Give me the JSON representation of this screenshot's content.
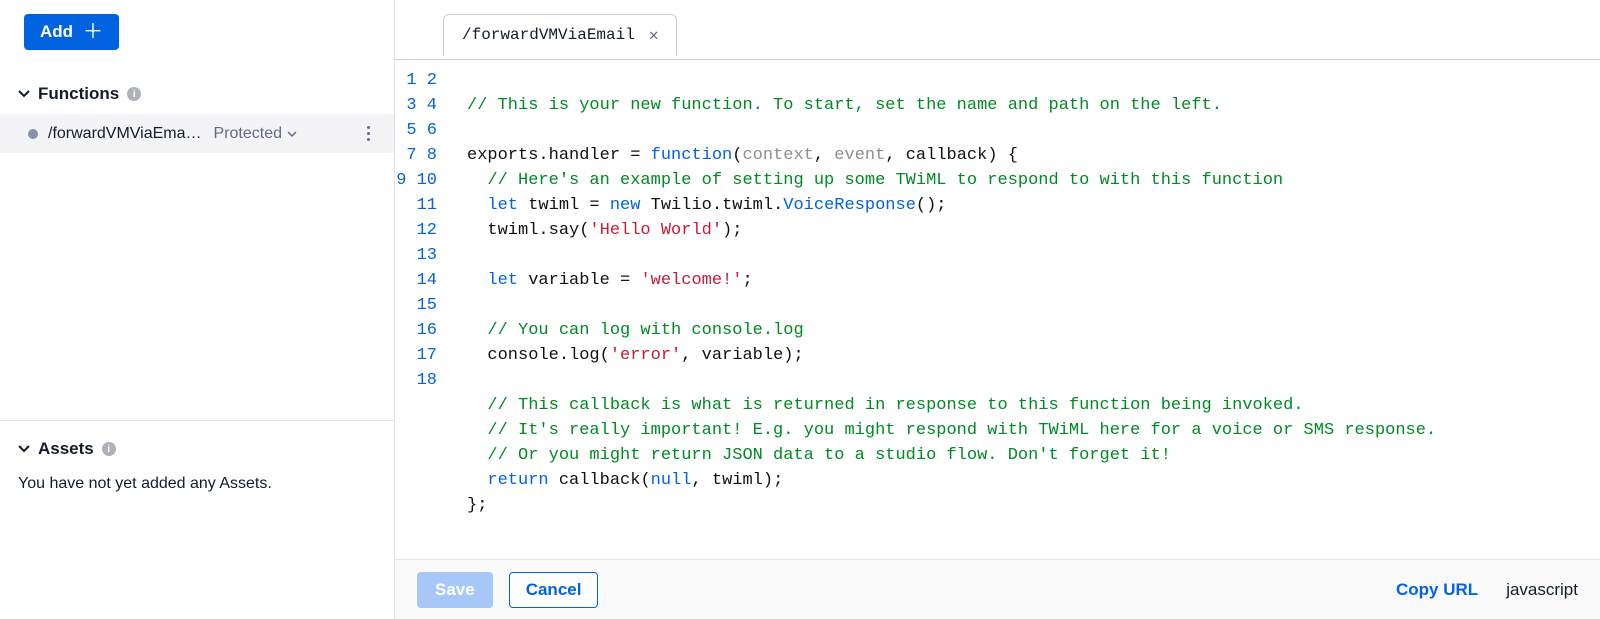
{
  "sidebar": {
    "add_label": "Add",
    "functions_header": "Functions",
    "assets_header": "Assets",
    "no_assets_text": "You have not yet added any Assets.",
    "function_item": {
      "name": "/forwardVMViaEma…",
      "badge": "Protected"
    }
  },
  "tab": {
    "title": "/forwardVMViaEmail"
  },
  "footer": {
    "save": "Save",
    "cancel": "Cancel",
    "copy_url": "Copy URL",
    "language": "javascript"
  },
  "code": {
    "line_count": 18,
    "lines": {
      "l1": "",
      "l2_comment": "// This is your new function. To start, set the name and path on the left.",
      "l3": "",
      "l4_a": "exports.handler = ",
      "l4_b": "function",
      "l4_c": "(",
      "l4_ctx": "context",
      "l4_comma1": ", ",
      "l4_evt": "event",
      "l4_comma2": ", callback) {",
      "l5_comment": "  // Here's an example of setting up some TWiML to respond to with this function",
      "l6_let": "  let",
      "l6_mid": " twiml = ",
      "l6_new": "new",
      "l6_tw": " Twilio.twiml.",
      "l6_vr": "VoiceResponse",
      "l6_end": "();",
      "l7_a": "  twiml.say(",
      "l7_str": "'Hello World'",
      "l7_b": ");",
      "l8": "",
      "l9_let": "  let",
      "l9_mid": " variable = ",
      "l9_str": "'welcome!'",
      "l9_end": ";",
      "l10": "",
      "l11_comment": "  // You can log with console.log",
      "l12_a": "  console.log(",
      "l12_str": "'error'",
      "l12_b": ", variable);",
      "l13": "",
      "l14_comment": "  // This callback is what is returned in response to this function being invoked.",
      "l15_comment": "  // It's really important! E.g. you might respond with TWiML here for a voice or SMS response.",
      "l16_comment": "  // Or you might return JSON data to a studio flow. Don't forget it!",
      "l17_ret": "  return",
      "l17_mid": " callback(",
      "l17_null": "null",
      "l17_end": ", twiml);",
      "l18": "};"
    }
  }
}
